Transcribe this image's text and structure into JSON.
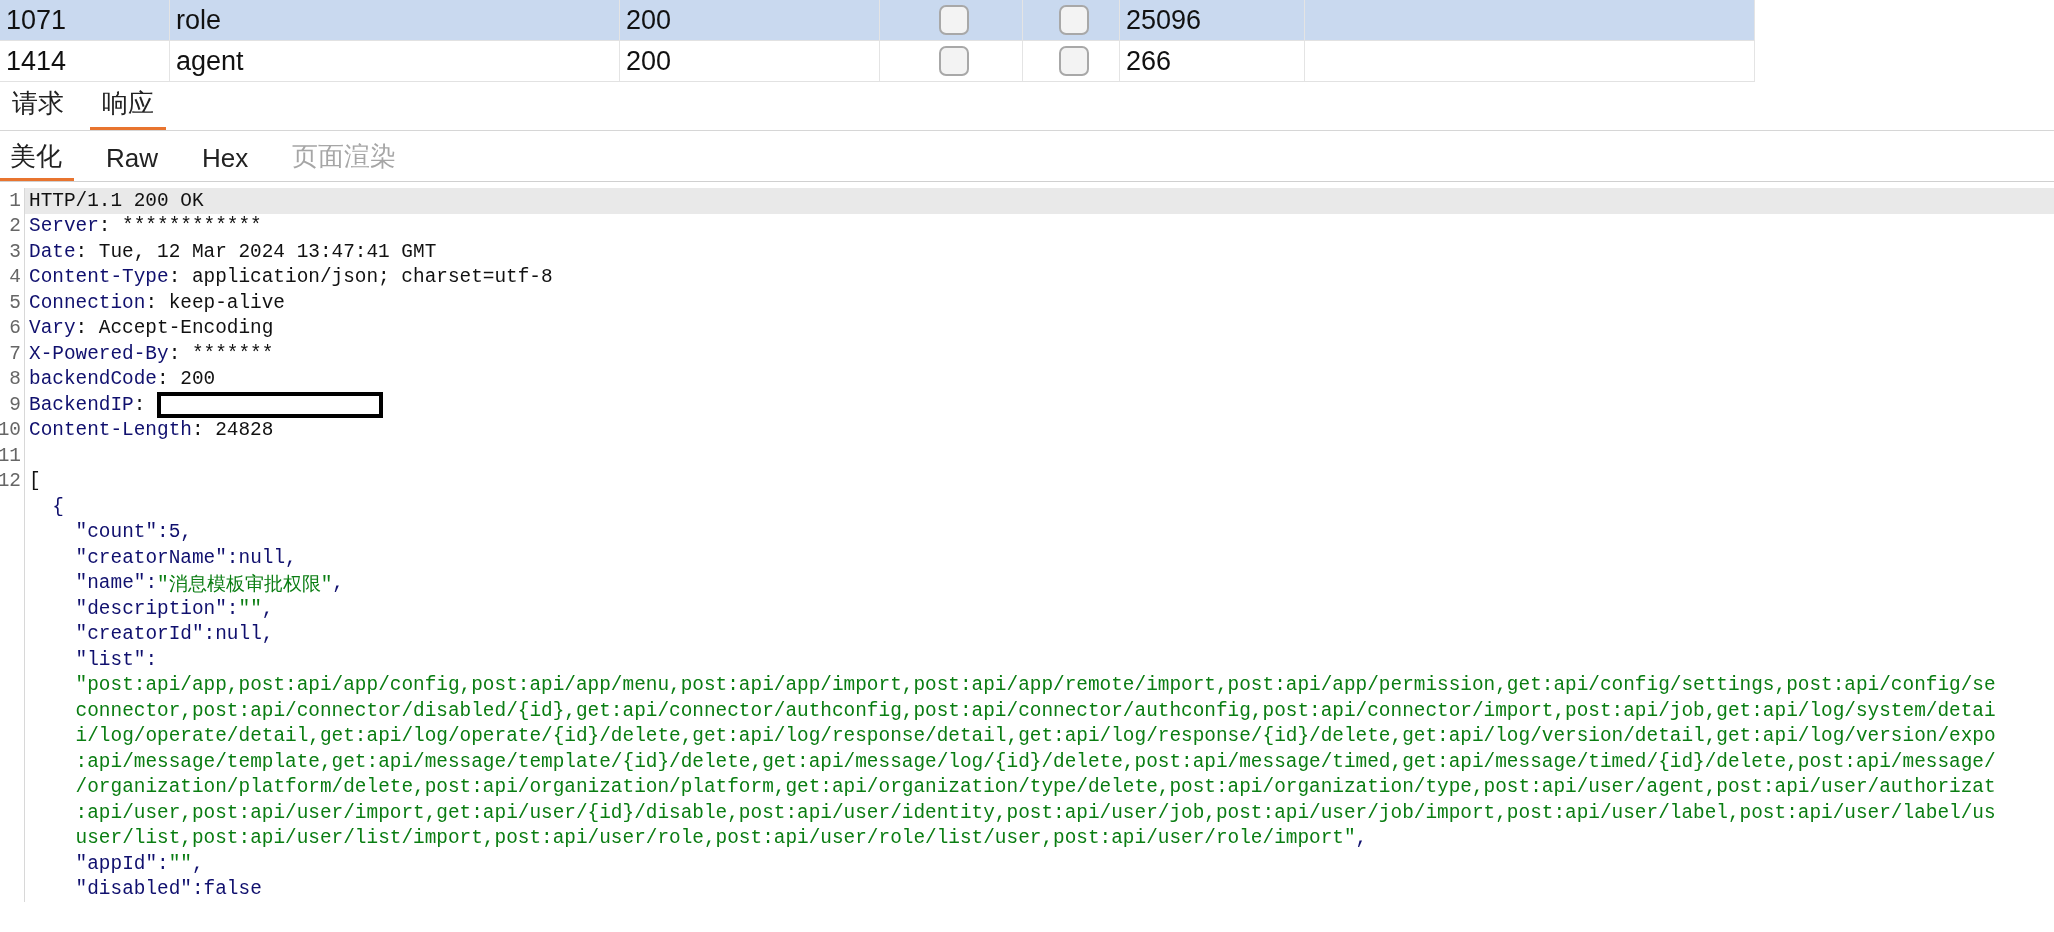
{
  "table": {
    "rows": [
      {
        "cells": [
          "1071",
          "role",
          "200",
          "25096"
        ],
        "checks": [
          {
            "checked": false
          },
          {
            "checked": false
          }
        ],
        "selected": true
      },
      {
        "cells": [
          "1414",
          "agent",
          "200",
          "266"
        ],
        "checks": [
          {
            "checked": false
          },
          {
            "checked": false
          }
        ],
        "selected": false
      }
    ]
  },
  "tabs": [
    {
      "label": "请求",
      "selected": false
    },
    {
      "label": "响应",
      "selected": true
    }
  ],
  "view_tabs": [
    {
      "label": "美化",
      "selected": true,
      "disabled": false
    },
    {
      "label": "Raw",
      "selected": false,
      "disabled": false
    },
    {
      "label": "Hex",
      "selected": false,
      "disabled": false
    },
    {
      "label": "页面渲染",
      "selected": false,
      "disabled": true
    }
  ],
  "editor": {
    "lines": [
      {
        "number": "1",
        "current": true,
        "segments": [
          {
            "text": "HTTP/1.1 200 OK",
            "kind": "value"
          }
        ]
      },
      {
        "number": "2",
        "current": false,
        "segments": [
          {
            "text": "Server",
            "kind": "name"
          },
          {
            "text": ": ************",
            "kind": "value"
          }
        ]
      },
      {
        "number": "3",
        "current": false,
        "segments": [
          {
            "text": "Date",
            "kind": "name"
          },
          {
            "text": ": Tue, 12 Mar 2024 13:47:41 GMT",
            "kind": "value"
          }
        ]
      },
      {
        "number": "4",
        "current": false,
        "segments": [
          {
            "text": "Content-Type",
            "kind": "name"
          },
          {
            "text": ": application/json; charset=utf-8",
            "kind": "value"
          }
        ]
      },
      {
        "number": "5",
        "current": false,
        "segments": [
          {
            "text": "Connection",
            "kind": "name"
          },
          {
            "text": ": keep-alive",
            "kind": "value"
          }
        ]
      },
      {
        "number": "6",
        "current": false,
        "segments": [
          {
            "text": "Vary",
            "kind": "name"
          },
          {
            "text": ": Accept-Encoding",
            "kind": "value"
          }
        ]
      },
      {
        "number": "7",
        "current": false,
        "segments": [
          {
            "text": "X-Powered-By",
            "kind": "name"
          },
          {
            "text": ": *******",
            "kind": "value"
          }
        ]
      },
      {
        "number": "8",
        "current": false,
        "segments": [
          {
            "text": "backendCode",
            "kind": "name"
          },
          {
            "text": ": 200",
            "kind": "value"
          }
        ]
      },
      {
        "number": "9",
        "current": false,
        "redacted": true,
        "segments": [
          {
            "text": "BackendIP",
            "kind": "name"
          },
          {
            "text": ":",
            "kind": "value"
          }
        ]
      },
      {
        "number": "10",
        "current": false,
        "segments": [
          {
            "text": "Content-Length",
            "kind": "name"
          },
          {
            "text": ": 24828",
            "kind": "value"
          }
        ]
      },
      {
        "number": "11",
        "current": false
      },
      {
        "number": "12",
        "current": false,
        "segments": [
          {
            "text": "[",
            "kind": "value"
          }
        ],
        "children": [
          {
            "current": false,
            "segments": [
              {
                "text": "{",
                "kind": "name"
              }
            ],
            "children": [
              {
                "current": false,
                "segments": [
                  {
                    "text": "\"count\":5,",
                    "kind": "name"
                  }
                ]
              },
              {
                "current": false,
                "segments": [
                  {
                    "text": "\"creatorName\":null,",
                    "kind": "name"
                  }
                ]
              },
              {
                "current": false,
                "segments": [
                  {
                    "text": "\"name\":",
                    "kind": "name"
                  },
                  {
                    "text": "\"消息模板审批权限\"",
                    "kind": "string"
                  },
                  {
                    "text": ",",
                    "kind": "name"
                  }
                ]
              },
              {
                "current": false,
                "segments": [
                  {
                    "text": "\"description\":",
                    "kind": "name"
                  },
                  {
                    "text": "\"\"",
                    "kind": "string"
                  },
                  {
                    "text": ",",
                    "kind": "name"
                  }
                ]
              },
              {
                "current": false,
                "segments": [
                  {
                    "text": "\"creatorId\":null,",
                    "kind": "name"
                  }
                ]
              },
              {
                "current": false,
                "segments": [
                  {
                    "text": "\"list\":",
                    "kind": "name"
                  }
                ]
              },
              {
                "current": false,
                "segments": [
                  {
                    "text": "\"post:api/app,post:api/app/config,post:api/app/menu,post:api/app/import,post:api/app/remote/import,post:api/app/permission,get:api/config/settings,post:api/config/se",
                    "kind": "string"
                  }
                ]
              },
              {
                "current": false,
                "segments": [
                  {
                    "text": "connector,post:api/connector/disabled/{id},get:api/connector/authconfig,post:api/connector/authconfig,post:api/connector/import,post:api/job,get:api/log/system/detai",
                    "kind": "string"
                  }
                ]
              },
              {
                "current": false,
                "segments": [
                  {
                    "text": "i/log/operate/detail,get:api/log/operate/{id}/delete,get:api/log/response/detail,get:api/log/response/{id}/delete,get:api/log/version/detail,get:api/log/version/expo",
                    "kind": "string"
                  }
                ]
              },
              {
                "current": false,
                "segments": [
                  {
                    "text": ":api/message/template,get:api/message/template/{id}/delete,get:api/message/log/{id}/delete,post:api/message/timed,get:api/message/timed/{id}/delete,post:api/message/",
                    "kind": "string"
                  }
                ]
              },
              {
                "current": false,
                "segments": [
                  {
                    "text": "/organization/platform/delete,post:api/organization/platform,get:api/organization/type/delete,post:api/organization/type,post:api/user/agent,post:api/user/authorizat",
                    "kind": "string"
                  }
                ]
              },
              {
                "current": false,
                "segments": [
                  {
                    "text": ":api/user,post:api/user/import,get:api/user/{id}/disable,post:api/user/identity,post:api/user/job,post:api/user/job/import,post:api/user/label,post:api/user/label/us",
                    "kind": "string"
                  }
                ]
              },
              {
                "current": false,
                "segments": [
                  {
                    "text": "user/list,post:api/user/list/import,post:api/user/role,post:api/user/role/list/user,post:api/user/role/import\"",
                    "kind": "string"
                  },
                  {
                    "text": ",",
                    "kind": "name"
                  }
                ]
              },
              {
                "current": false,
                "segments": [
                  {
                    "text": "\"appId\":",
                    "kind": "name"
                  },
                  {
                    "text": "\"\"",
                    "kind": "string"
                  },
                  {
                    "text": ",",
                    "kind": "name"
                  }
                ]
              },
              {
                "current": false,
                "segments": [
                  {
                    "text": "\"disabled\":false",
                    "kind": "name"
                  }
                ]
              }
            ]
          }
        ]
      }
    ]
  }
}
